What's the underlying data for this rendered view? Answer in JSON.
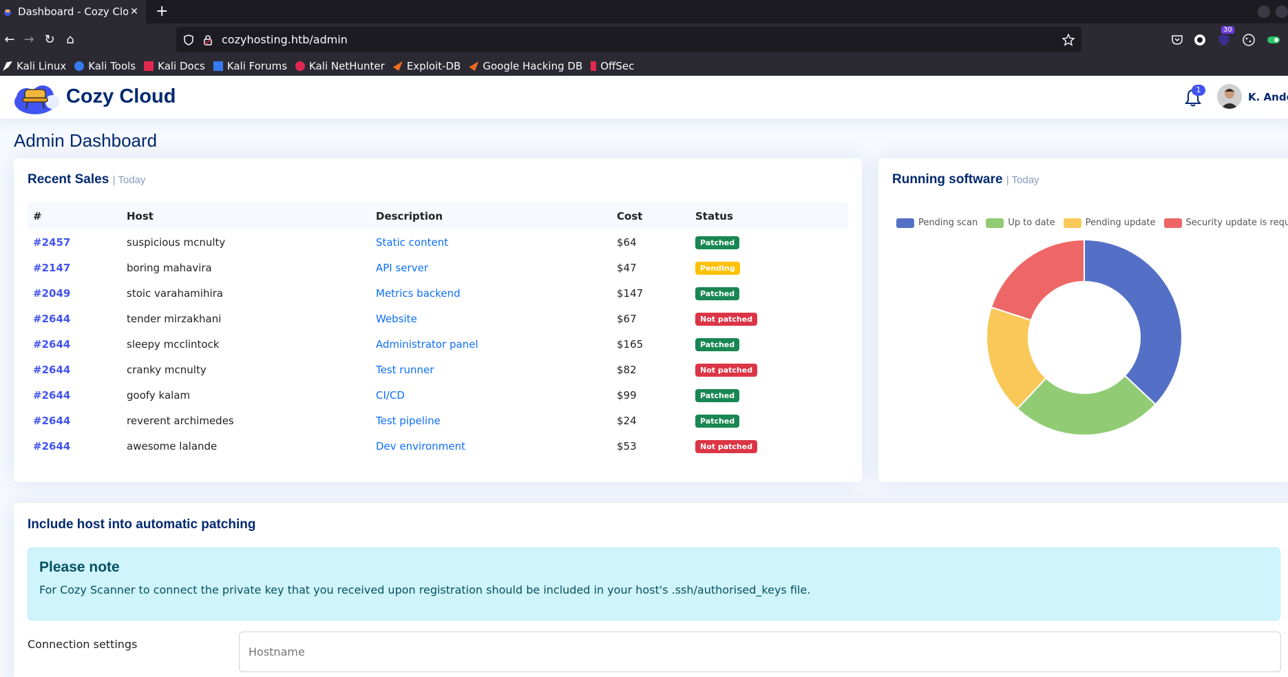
{
  "browser": {
    "tab_title": "Dashboard - Cozy Cloud",
    "tab_close": "✕",
    "new_tab": "+",
    "url": "cozyhosting.htb/admin",
    "bookmarks": [
      "Kali Linux",
      "Kali Tools",
      "Kali Docs",
      "Kali Forums",
      "Kali NetHunter",
      "Exploit-DB",
      "Google Hacking DB",
      "OffSec"
    ],
    "extension_badge": "30"
  },
  "header": {
    "brand": "Cozy Cloud",
    "notification_count": "1",
    "username": "K. Anderson"
  },
  "page_title": "Admin Dashboard",
  "sales": {
    "title": "Recent Sales",
    "subtitle": "| Today",
    "columns": [
      "#",
      "Host",
      "Description",
      "Cost",
      "Status"
    ],
    "rows": [
      {
        "id": "#2457",
        "host": "suspicious mcnulty",
        "description": "Static content",
        "cost": "$64",
        "status": "Patched"
      },
      {
        "id": "#2147",
        "host": "boring mahavira",
        "description": "API server",
        "cost": "$47",
        "status": "Pending"
      },
      {
        "id": "#2049",
        "host": "stoic varahamihira",
        "description": "Metrics backend",
        "cost": "$147",
        "status": "Patched"
      },
      {
        "id": "#2644",
        "host": "tender mirzakhani",
        "description": "Website",
        "cost": "$67",
        "status": "Not patched"
      },
      {
        "id": "#2644",
        "host": "sleepy mcclintock",
        "description": "Administrator panel",
        "cost": "$165",
        "status": "Patched"
      },
      {
        "id": "#2644",
        "host": "cranky mcnulty",
        "description": "Test runner",
        "cost": "$82",
        "status": "Not patched"
      },
      {
        "id": "#2644",
        "host": "goofy kalam",
        "description": "CI/CD",
        "cost": "$99",
        "status": "Patched"
      },
      {
        "id": "#2644",
        "host": "reverent archimedes",
        "description": "Test pipeline",
        "cost": "$24",
        "status": "Patched"
      },
      {
        "id": "#2644",
        "host": "awesome lalande",
        "description": "Dev environment",
        "cost": "$53",
        "status": "Not patched"
      }
    ]
  },
  "software": {
    "title": "Running software",
    "subtitle": "| Today"
  },
  "chart_data": {
    "type": "pie",
    "donut": true,
    "categories": [
      "Pending scan",
      "Up to date",
      "Pending update",
      "Security update is required"
    ],
    "values": [
      37,
      25,
      18,
      20
    ],
    "colors": [
      "#5470c6",
      "#91cc75",
      "#fac858",
      "#ee6666"
    ],
    "legend_position": "top"
  },
  "patching": {
    "title": "Include host into automatic patching",
    "note_heading": "Please note",
    "note_text": "For Cozy Scanner to connect the private key that you received upon registration should be included in your host's .ssh/authorised_keys file.",
    "connection_label": "Connection settings",
    "hostname_placeholder": "Hostname"
  }
}
